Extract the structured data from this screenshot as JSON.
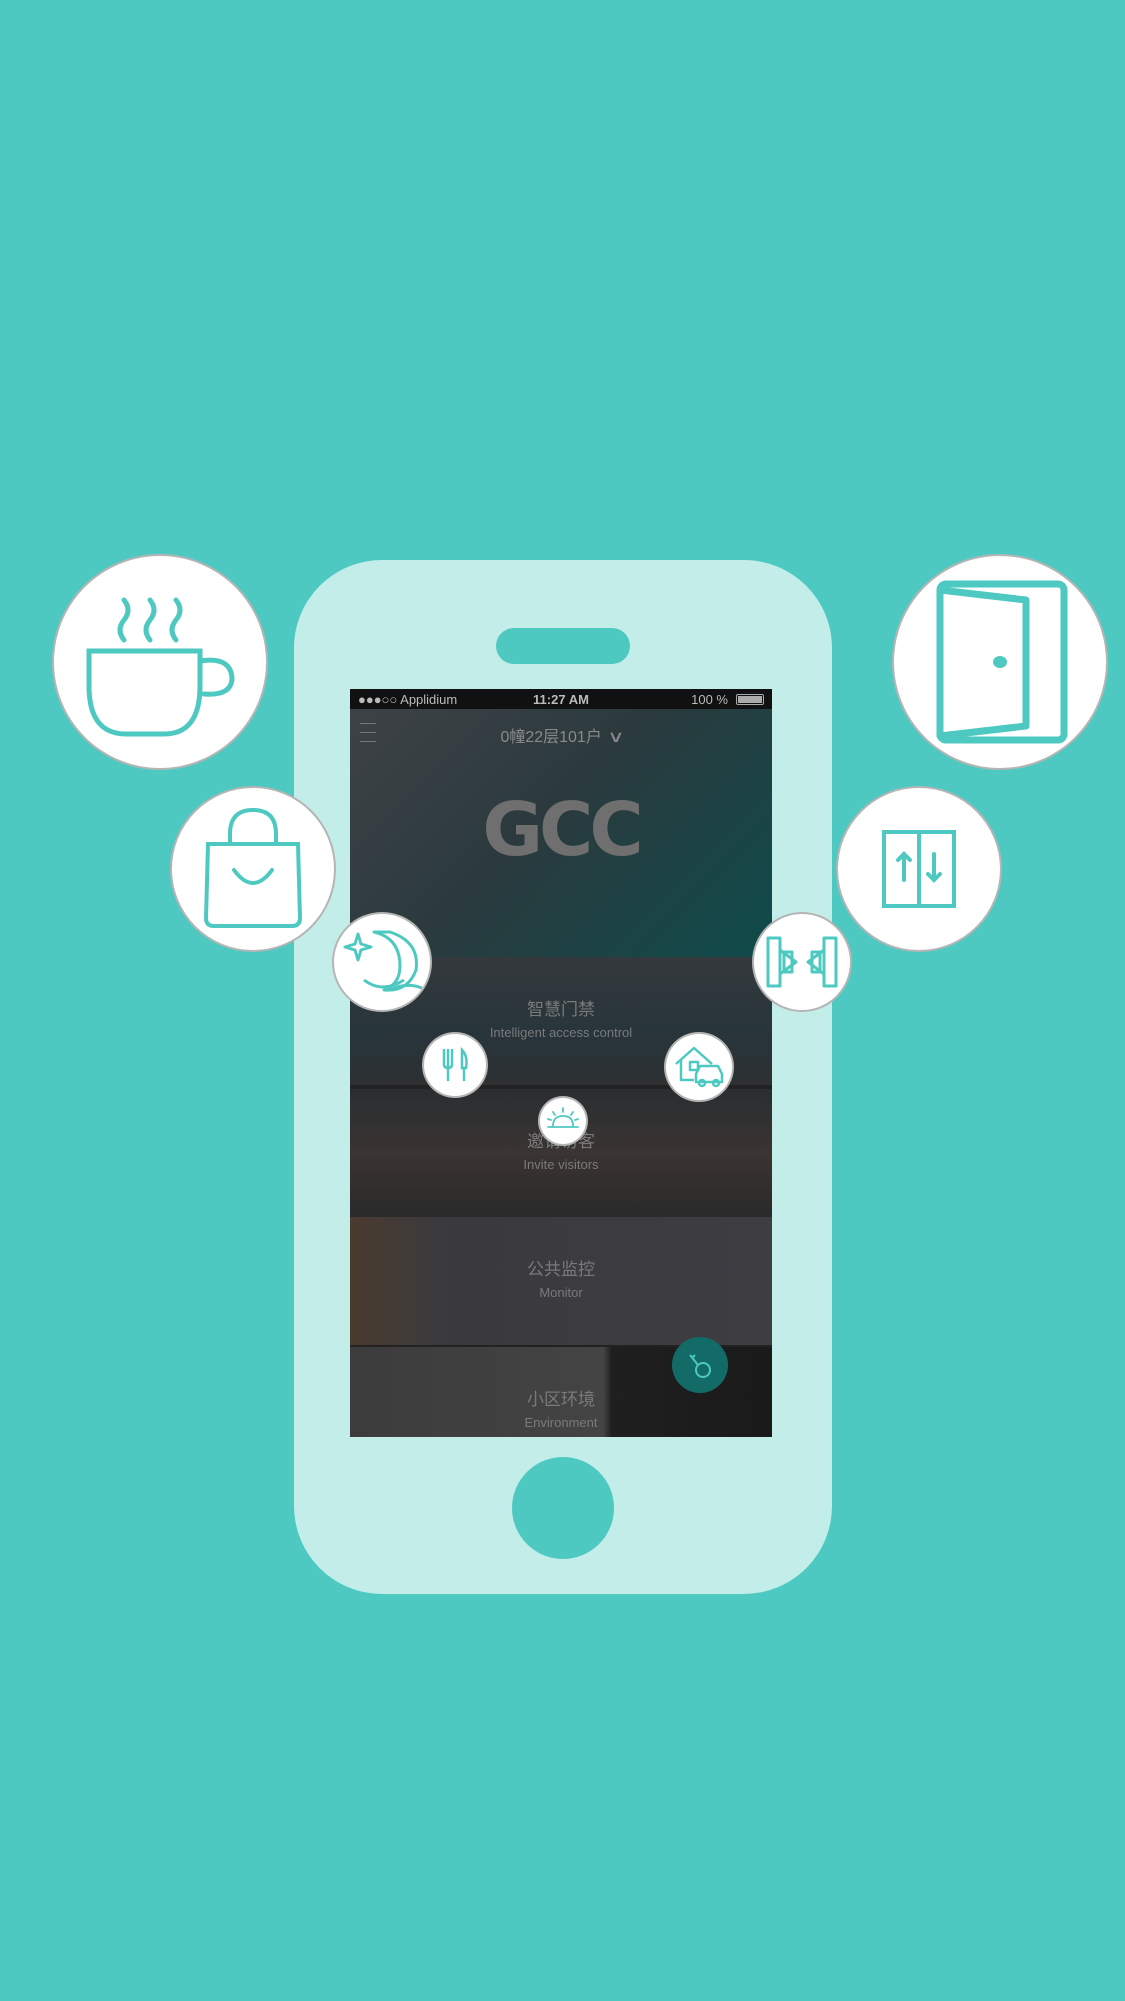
{
  "status_bar": {
    "carrier": "●●●○○ Applidium",
    "time": "11:27 AM",
    "battery": "100 %"
  },
  "header": {
    "unit_selector": "0幢22层101户",
    "logo_text": "GCC"
  },
  "menu": [
    {
      "title": "智慧门禁",
      "subtitle": "Intelligent access control"
    },
    {
      "title": "邀请访客",
      "subtitle": "Invite visitors"
    },
    {
      "title": "公共监控",
      "subtitle": "Monitor"
    },
    {
      "title": "小区环境",
      "subtitle": "Environment"
    }
  ],
  "feature_icons": [
    "coffee-cup-icon",
    "shopping-bag-icon",
    "night-moon-icon",
    "dining-icon",
    "sunrise-icon",
    "door-icon",
    "elevator-icon",
    "gate-icon",
    "home-car-icon"
  ],
  "colors": {
    "background": "#4ec9c1",
    "phone_body": "#c3ede9",
    "icon_stroke": "#4ec9c1",
    "fab": "#136b67"
  }
}
